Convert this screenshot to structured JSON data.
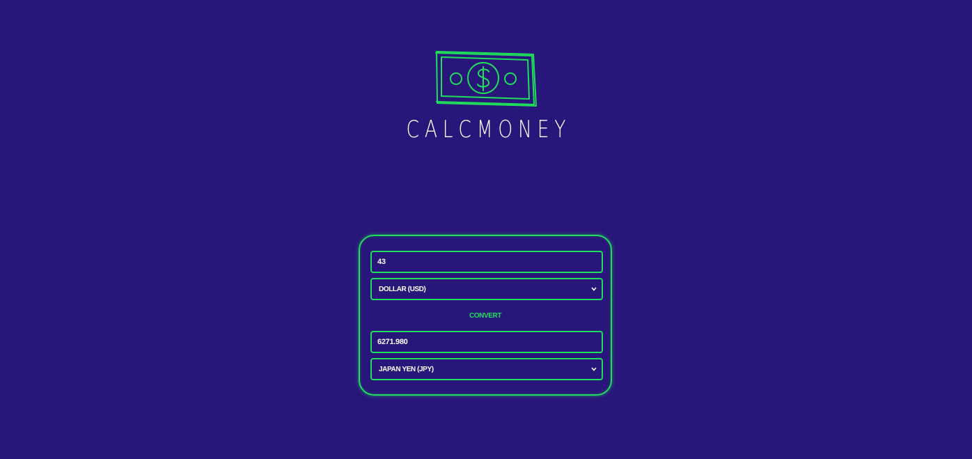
{
  "brand": {
    "name": "CALCMONEY",
    "logo_icon": "dollar-bill-icon"
  },
  "converter": {
    "amount_value": "43",
    "from_currency": "DOLLAR (USD)",
    "convert_label": "CONVERT",
    "result_value": "6271.980",
    "to_currency": "JAPAN YEN (JPY)"
  },
  "colors": {
    "background": "#29167a",
    "accent": "#1fe05a",
    "text": "#ffffff"
  }
}
